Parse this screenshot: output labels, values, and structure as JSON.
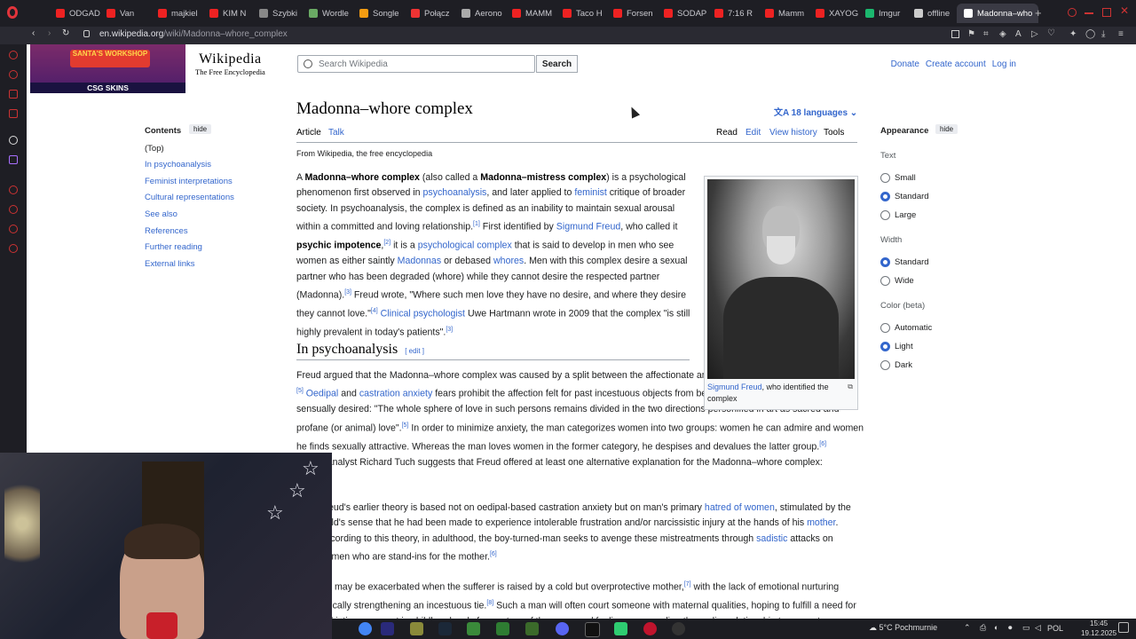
{
  "browser": {
    "tabs": [
      "ODGAD",
      "Van",
      "majkiel",
      "KIM N",
      "Szybki",
      "Wordle",
      "Songle",
      "Połącz",
      "Aerono",
      "MAMM",
      "Taco H",
      "Forsen",
      "SODAP",
      "7:16 R",
      "Mamm",
      "XAYOG",
      "Imgur",
      "offline",
      "Madonna–who"
    ],
    "url_domain": "en.wikipedia.org",
    "url_path": "/wiki/Madonna–whore_complex"
  },
  "banner": {
    "top": "SANTA'S WORKSHOP",
    "bottom": "CSG SKINS"
  },
  "header": {
    "logo_title": "Wikipedia",
    "logo_tagline": "The Free Encyclopedia",
    "search_placeholder": "Search Wikipedia",
    "search_button": "Search",
    "links": [
      "Donate",
      "Create account",
      "Log in"
    ]
  },
  "toc": {
    "heading": "Contents",
    "hide": "hide",
    "items": [
      "(Top)",
      "In psychoanalysis",
      "Feminist interpretations",
      "Cultural representations",
      "See also",
      "References",
      "Further reading",
      "External links"
    ]
  },
  "article": {
    "title": "Madonna–whore complex",
    "languages": "18 languages",
    "tabs": [
      "Article",
      "Talk",
      "Read",
      "Edit",
      "View history",
      "Tools"
    ],
    "from": "From Wikipedia, the free encyclopedia",
    "section": "In psychoanalysis",
    "edit": "edit"
  },
  "infobox": {
    "caption_link": "Sigmund Freud",
    "caption_rest": ", who identified the complex"
  },
  "appearance": {
    "heading": "Appearance",
    "hide": "hide",
    "text_label": "Text",
    "text_options": [
      "Small",
      "Standard",
      "Large"
    ],
    "width_label": "Width",
    "width_options": [
      "Standard",
      "Wide"
    ],
    "color_label": "Color (beta)",
    "color_options": [
      "Automatic",
      "Light",
      "Dark"
    ]
  },
  "taskbar": {
    "weather": "5°C Pochmurnie",
    "lang": "POL",
    "time": "15:45",
    "date": "19.12.2025"
  }
}
